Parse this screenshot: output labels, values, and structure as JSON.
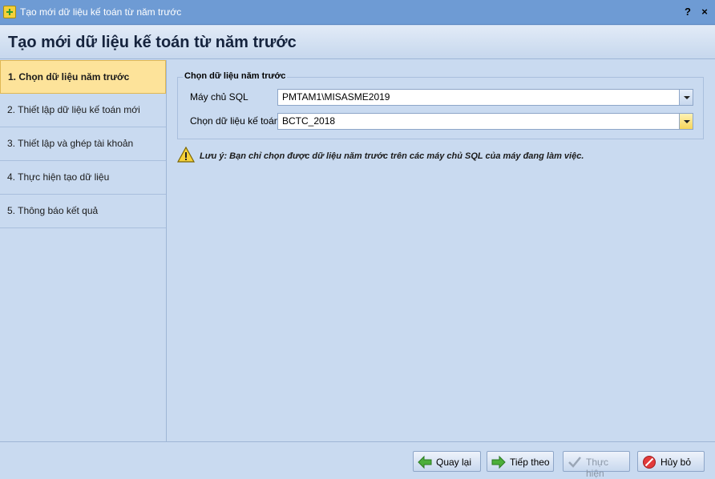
{
  "window": {
    "title": "Tạo mới dữ liệu kế toán từ năm trước",
    "help_label": "?",
    "close_label": "×"
  },
  "header": {
    "title": "Tạo mới dữ liệu kế toán từ năm trước"
  },
  "steps": [
    {
      "label": "1. Chọn dữ liệu năm trước",
      "active": true
    },
    {
      "label": "2. Thiết lập dữ liệu kế toán mới",
      "active": false
    },
    {
      "label": "3. Thiết lập và ghép tài khoản",
      "active": false
    },
    {
      "label": "4. Thực hiện tạo dữ liệu",
      "active": false
    },
    {
      "label": "5. Thông báo kết quả",
      "active": false
    }
  ],
  "group": {
    "title": "Chọn dữ liệu năm trước",
    "sql_server_label": "Máy chủ SQL",
    "sql_server_value": "PMTAM1\\MISASME2019",
    "database_label": "Chọn dữ liệu kế toán",
    "database_value": "BCTC_2018"
  },
  "note": "Lưu ý: Bạn chỉ chọn được dữ liệu năm trước trên các máy chủ SQL của máy đang làm việc.",
  "footer": {
    "back_label": "Quay lại",
    "next_label": "Tiếp theo",
    "execute_label": "Thực hiện",
    "cancel_label": "Hủy bỏ"
  },
  "colors": {
    "titlebar": "#6e9bd4",
    "panel": "#c9daf0",
    "active_step": "#fde39a"
  }
}
